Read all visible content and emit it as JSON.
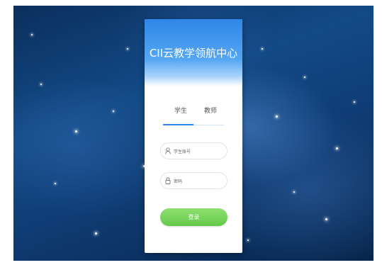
{
  "header": {
    "title": "CII云教学领航中心"
  },
  "tabs": [
    {
      "label": "学生",
      "active": true
    },
    {
      "label": "教师",
      "active": false
    }
  ],
  "form": {
    "username_placeholder": "学生账号",
    "username_icon": "user-icon",
    "password_placeholder": "密码",
    "password_icon": "lock-icon",
    "login_label": "登录"
  },
  "colors": {
    "accent": "#2f86e8",
    "login_button": "#6fcf52",
    "background": "#0f3c74"
  }
}
